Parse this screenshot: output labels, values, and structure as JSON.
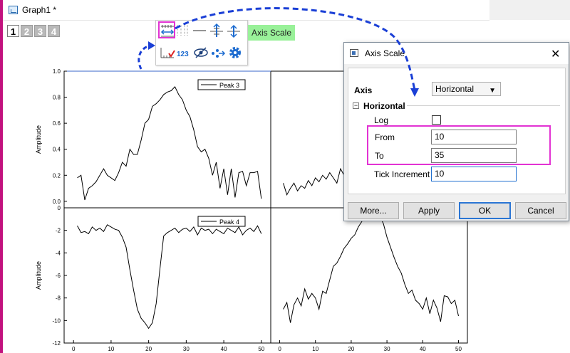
{
  "window": {
    "title": "Graph1 *"
  },
  "layer_tabs": [
    "1",
    "2",
    "3",
    "4"
  ],
  "tooltip": "Axis Scale",
  "dialog": {
    "title": "Axis Scale",
    "axis_label": "Axis",
    "axis_value": "Horizontal",
    "section_label": "Horizontal",
    "log_label": "Log",
    "from_label": "From",
    "from_value": "10",
    "to_label": "To",
    "to_value": "35",
    "tick_label": "Tick Increment",
    "tick_value": "10",
    "buttons": {
      "more": "More...",
      "apply": "Apply",
      "ok": "OK",
      "cancel": "Cancel"
    }
  },
  "colors": {
    "highlight": "#e233d3",
    "tooltip_bg": "#99f199",
    "arrow": "#1a3fd6",
    "window_border": "#c2127e"
  },
  "icons": [
    "axis-scale-icon",
    "tick-labels-icon",
    "line-icon",
    "axis-break-icon",
    "axis-offset-icon",
    "tick-check-icon",
    "numbering-icon",
    "hide-icon",
    "scatter-icon",
    "gear-icon"
  ],
  "chart_data": [
    {
      "type": "line",
      "panel": "top-left",
      "ylabel": "Amplitude",
      "legend": "Peak 3",
      "yticks": [
        "1.0",
        "0.8",
        "0.6",
        "0.4",
        "0.2",
        "0.0"
      ],
      "ylim": [
        -0.05,
        1.0
      ],
      "xlim": [
        -2.5,
        52.5
      ],
      "series": [
        {
          "name": "Peak 3",
          "x": [
            1,
            2,
            3,
            4,
            5,
            6,
            7,
            8,
            9,
            10,
            11,
            12,
            13,
            14,
            15,
            16,
            17,
            18,
            19,
            20,
            21,
            22,
            23,
            24,
            25,
            26,
            27,
            28,
            29,
            30,
            31,
            32,
            33,
            34,
            35,
            36,
            37,
            38,
            39,
            40,
            41,
            42,
            43,
            44,
            45,
            46,
            47,
            48,
            49,
            50
          ],
          "y": [
            0.18,
            0.2,
            0.01,
            0.1,
            0.12,
            0.15,
            0.2,
            0.25,
            0.2,
            0.18,
            0.16,
            0.22,
            0.3,
            0.27,
            0.4,
            0.36,
            0.36,
            0.47,
            0.6,
            0.63,
            0.73,
            0.75,
            0.78,
            0.82,
            0.84,
            0.85,
            0.88,
            0.82,
            0.78,
            0.7,
            0.65,
            0.55,
            0.42,
            0.38,
            0.4,
            0.33,
            0.2,
            0.3,
            0.1,
            0.25,
            0.05,
            0.25,
            0.03,
            0.22,
            0.23,
            0.12,
            0.22,
            0.22,
            0.23,
            0.02
          ]
        }
      ]
    },
    {
      "type": "line",
      "panel": "bottom-left",
      "ylabel": "Amplitude",
      "legend": "Peak 4",
      "yticks": [
        "0",
        "-2",
        "-4",
        "-6",
        "-8",
        "-10",
        "-12"
      ],
      "xticks": [
        "0",
        "10",
        "20",
        "30",
        "40",
        "50"
      ],
      "ylim": [
        -12,
        0
      ],
      "xlim": [
        -2.5,
        52.5
      ],
      "series": [
        {
          "name": "Peak 4",
          "x": [
            1,
            2,
            3,
            4,
            5,
            6,
            7,
            8,
            9,
            10,
            11,
            12,
            13,
            14,
            15,
            16,
            17,
            18,
            19,
            20,
            21,
            22,
            23,
            24,
            25,
            26,
            27,
            28,
            29,
            30,
            31,
            32,
            33,
            34,
            35,
            36,
            37,
            38,
            39,
            40,
            41,
            42,
            43,
            44,
            45,
            46,
            47,
            48,
            49,
            50
          ],
          "y": [
            -1.6,
            -2.2,
            -2.1,
            -2.3,
            -1.7,
            -2.0,
            -1.8,
            -2.1,
            -1.5,
            -1.7,
            -1.9,
            -2.0,
            -2.6,
            -3.5,
            -5.5,
            -7.3,
            -9.0,
            -9.8,
            -10.2,
            -10.7,
            -10.2,
            -8.5,
            -5.4,
            -2.5,
            -2.2,
            -2.0,
            -1.8,
            -2.2,
            -1.9,
            -1.8,
            -2.1,
            -1.7,
            -2.4,
            -1.8,
            -2.0,
            -1.9,
            -2.3,
            -1.9,
            -2.1,
            -2.3,
            -1.8,
            -2.0,
            -2.2,
            -1.7,
            -2.4,
            -2.0,
            -1.8,
            -2.1,
            -1.6,
            -2.3
          ]
        }
      ]
    },
    {
      "type": "line",
      "panel": "top-right",
      "ylim": [
        -0.05,
        1.0
      ],
      "xlim": [
        -2.5,
        52.5
      ],
      "series": [
        {
          "x": [
            1,
            2,
            3,
            4,
            5,
            6,
            7,
            8,
            9,
            10,
            11,
            12,
            13,
            14,
            15,
            16,
            17,
            18,
            19,
            20,
            21,
            22,
            23,
            24,
            25,
            26,
            27,
            28,
            29,
            30,
            31,
            32,
            33,
            34
          ],
          "y": [
            0.14,
            0.05,
            0.1,
            0.14,
            0.08,
            0.12,
            0.1,
            0.16,
            0.12,
            0.18,
            0.15,
            0.2,
            0.17,
            0.22,
            0.18,
            0.14,
            0.25,
            0.2,
            0.27,
            0.18,
            0.3,
            0.45,
            0.42,
            0.55,
            0.48,
            0.52,
            0.45,
            0.55,
            0.5,
            0.58,
            0.52,
            0.6,
            0.62,
            0.65
          ]
        }
      ]
    },
    {
      "type": "line",
      "panel": "bottom-right",
      "xticks": [
        "0",
        "10",
        "20",
        "30",
        "40",
        "50"
      ],
      "ylim": [
        -12,
        0
      ],
      "xlim": [
        -2.5,
        52.5
      ],
      "series": [
        {
          "x": [
            1,
            2,
            3,
            4,
            5,
            6,
            7,
            8,
            9,
            10,
            11,
            12,
            13,
            14,
            15,
            16,
            17,
            18,
            19,
            20,
            21,
            22,
            23,
            24,
            25,
            26,
            27,
            28,
            29,
            30,
            31,
            32,
            33,
            34,
            35,
            36,
            37,
            38,
            39,
            40,
            41,
            42,
            43,
            44,
            45,
            46,
            47,
            48,
            49,
            50
          ],
          "y": [
            -9.0,
            -8.4,
            -10.2,
            -8.6,
            -8.0,
            -8.7,
            -7.2,
            -8.1,
            -7.6,
            -8.0,
            -9.0,
            -7.4,
            -7.6,
            -6.4,
            -5.2,
            -4.9,
            -4.3,
            -3.6,
            -3.2,
            -2.7,
            -2.4,
            -1.7,
            -1.2,
            -0.7,
            -0.3,
            0.0,
            -0.4,
            -0.8,
            -1.4,
            -2.6,
            -3.5,
            -4.4,
            -5.2,
            -5.8,
            -6.8,
            -7.6,
            -7.3,
            -8.2,
            -8.5,
            -9.0,
            -8.0,
            -9.4,
            -8.2,
            -8.9,
            -10.1,
            -7.8,
            -7.9,
            -8.5,
            -8.2,
            -9.6
          ]
        }
      ]
    }
  ]
}
